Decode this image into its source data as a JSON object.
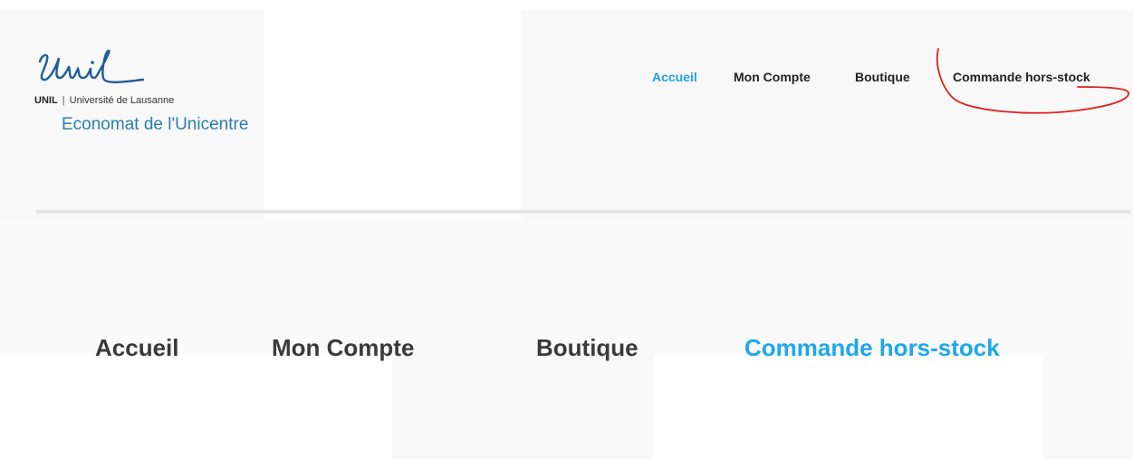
{
  "header": {
    "logo_wordmark": "Unil",
    "institution_abbr": "UNIL",
    "institution_separator": "|",
    "institution_name": "Université de Lausanne",
    "site_name": "Economat de l'Unicentre"
  },
  "top_nav": {
    "items": [
      {
        "label": "Accueil",
        "active": true
      },
      {
        "label": "Mon Compte",
        "active": false
      },
      {
        "label": "Boutique",
        "active": false
      },
      {
        "label": "Commande hors-stock",
        "active": false
      }
    ]
  },
  "bottom_nav": {
    "items": [
      {
        "label": "Accueil",
        "active": false
      },
      {
        "label": "Mon Compte",
        "active": false
      },
      {
        "label": "Boutique",
        "active": false
      },
      {
        "label": "Commande hors-stock",
        "active": true
      }
    ]
  },
  "colors": {
    "active_link": "#1da1e2",
    "inactive_link": "#222222",
    "site_name": "#2b7fae",
    "logo": "#1f5c99",
    "annotation": "#e02020"
  },
  "icons": {
    "logo": "unil-script-logo",
    "annotation": "red-hand-drawn-ellipse"
  }
}
